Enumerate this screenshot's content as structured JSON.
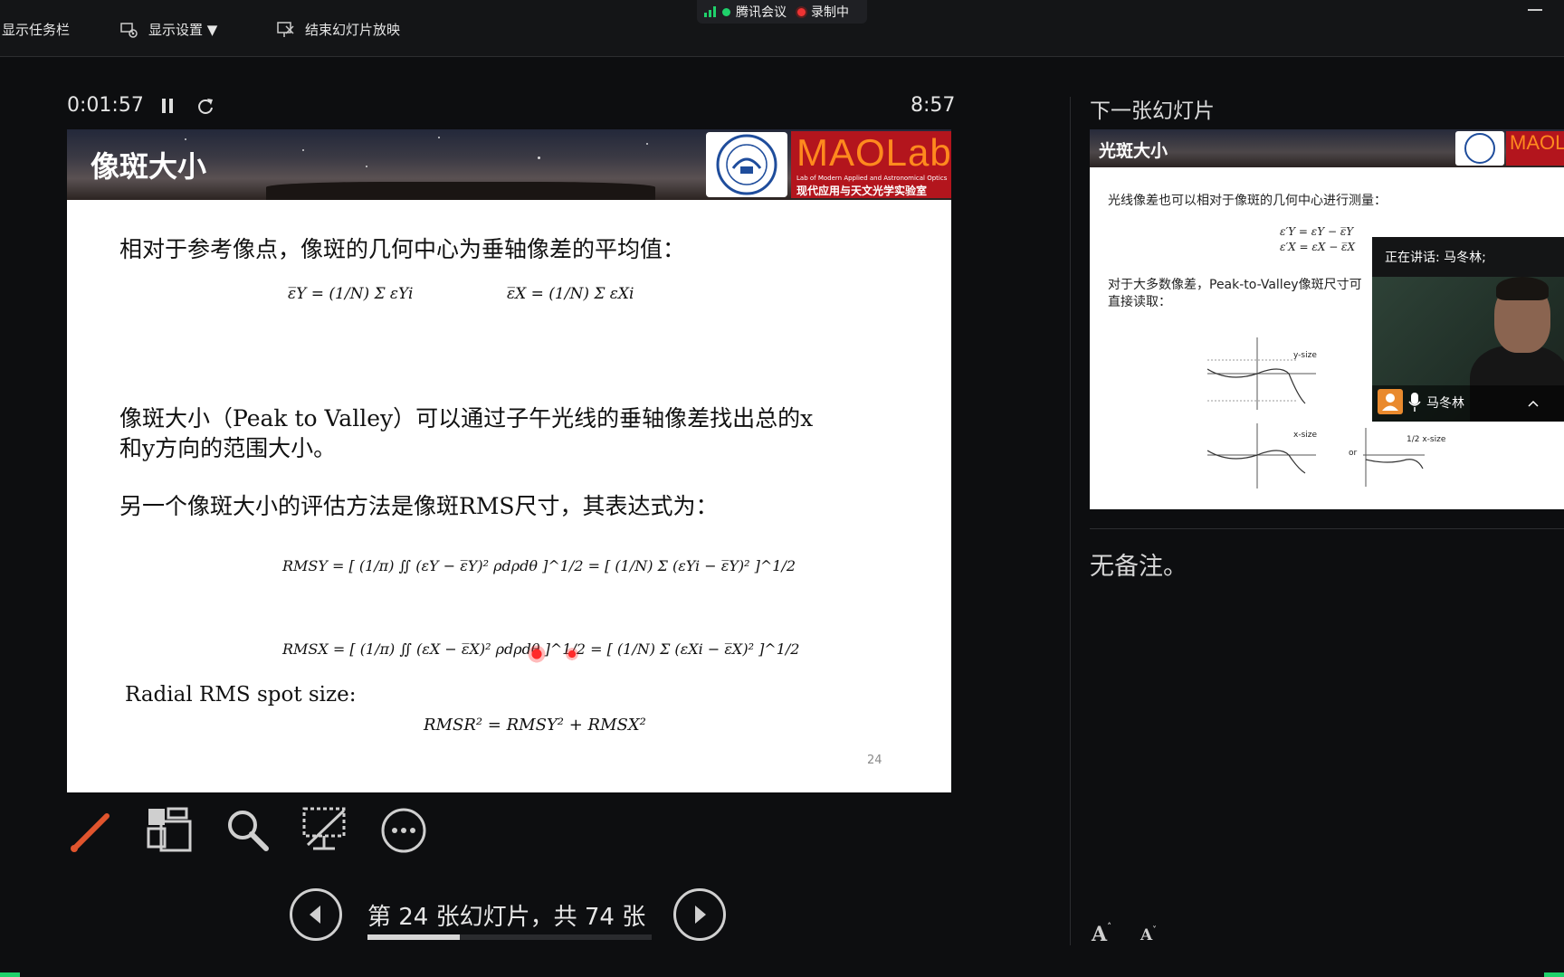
{
  "topbar": {
    "show_taskbar": "显示任务栏",
    "display_settings": "显示设置 ▼",
    "end_slideshow": "结束幻灯片放映",
    "meeting_app": "腾讯会议",
    "recording": "录制中"
  },
  "presenter": {
    "elapsed": "0:01:57",
    "clock": "8:57"
  },
  "slide": {
    "title": "像斑大小",
    "logo_text": "MAOLab",
    "logo_sub_en": "Lab of Modern Applied and Astronomical Optics",
    "logo_sub_cn": "现代应用与天文光学实验室",
    "line1": "相对于参考像点，像斑的几何中心为垂轴像差的平均值：",
    "eq_mean_y": "ε̅Y = (1/N) Σ εYi",
    "eq_mean_x": "ε̅X = (1/N) Σ εXi",
    "line2a": "像斑大小（Peak to Valley）可以通过子午光线的垂轴像差找出总的x",
    "line2b": "和y方向的范围大小。",
    "line3": "另一个像斑大小的评估方法是像斑RMS尺寸，其表达式为：",
    "eq_rms_y": "RMSY = [ (1/π) ∬ (εY − ε̅Y)² ρdρdθ ]^1/2 = [ (1/N) Σ (εYi − ε̅Y)² ]^1/2",
    "eq_rms_x": "RMSX = [ (1/π) ∬ (εX − ε̅X)² ρdρdθ ]^1/2 = [ (1/N) Σ (εXi − ε̅X)² ]^1/2",
    "radial_label": "Radial RMS spot size:",
    "eq_radial": "RMSR² = RMSY² + RMSX²",
    "page_number": "24"
  },
  "navigation": {
    "slide_counter": "第 24 张幻灯片，共 74 张",
    "progress": 0.3243
  },
  "next_slide": {
    "header": "下一张幻灯片",
    "title": "光斑大小",
    "line1": "光线像差也可以相对于像斑的几何中心进行测量：",
    "eq1": "ε′Y = εY − ε̅Y",
    "eq2": "ε′X = εX − ε̅X",
    "line2a": "对于大多数像差，Peak-to-Valley像斑尺寸可",
    "line2b": "直接读取：",
    "plot_label_y": "y-size",
    "plot_label_x": "x-size",
    "plot_label_half": "1/2 x-size",
    "plot_or": "or"
  },
  "notes": {
    "text": "无备注。"
  },
  "video": {
    "speaking": "正在讲话: 马冬林;",
    "name": "马冬林"
  },
  "font_buttons": {
    "increase": "A",
    "decrease": "A"
  },
  "colors": {
    "background": "#0d0e10",
    "accent_green": "#1fd16b",
    "logo_red": "#b3151d",
    "logo_orange": "#ff8a1e",
    "laser_red": "#ff2a2a"
  }
}
